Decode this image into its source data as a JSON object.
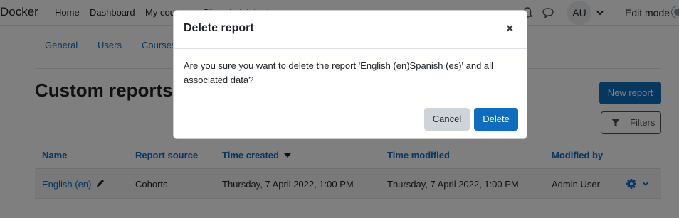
{
  "navbar": {
    "brand": "Docker",
    "links": [
      "Home",
      "Dashboard",
      "My courses",
      "Site administration"
    ],
    "avatar_initials": "AU",
    "edit_mode_label": "Edit mode"
  },
  "secondary_nav": [
    "General",
    "Users",
    "Courses"
  ],
  "page": {
    "title": "Custom reports",
    "new_report_label": "New report",
    "filters_label": "Filters"
  },
  "table": {
    "headers": [
      "Name",
      "Report source",
      "Time created",
      "Time modified",
      "Modified by"
    ],
    "rows": [
      {
        "name": "English (en)",
        "source": "Cohorts",
        "created": "Thursday, 7 April 2022, 1:00 PM",
        "modified": "Thursday, 7 April 2022, 1:00 PM",
        "modified_by": "Admin User"
      }
    ]
  },
  "modal": {
    "title": "Delete report",
    "close_glyph": "×",
    "body": "Are you sure you want to delete the report 'English (en)Spanish (es)' and all associated data?",
    "cancel_label": "Cancel",
    "delete_label": "Delete"
  },
  "colors": {
    "primary": "#0f6cbf",
    "secondary_button": "#ced4da",
    "backdrop": "rgba(0,0,0,0.5)"
  }
}
